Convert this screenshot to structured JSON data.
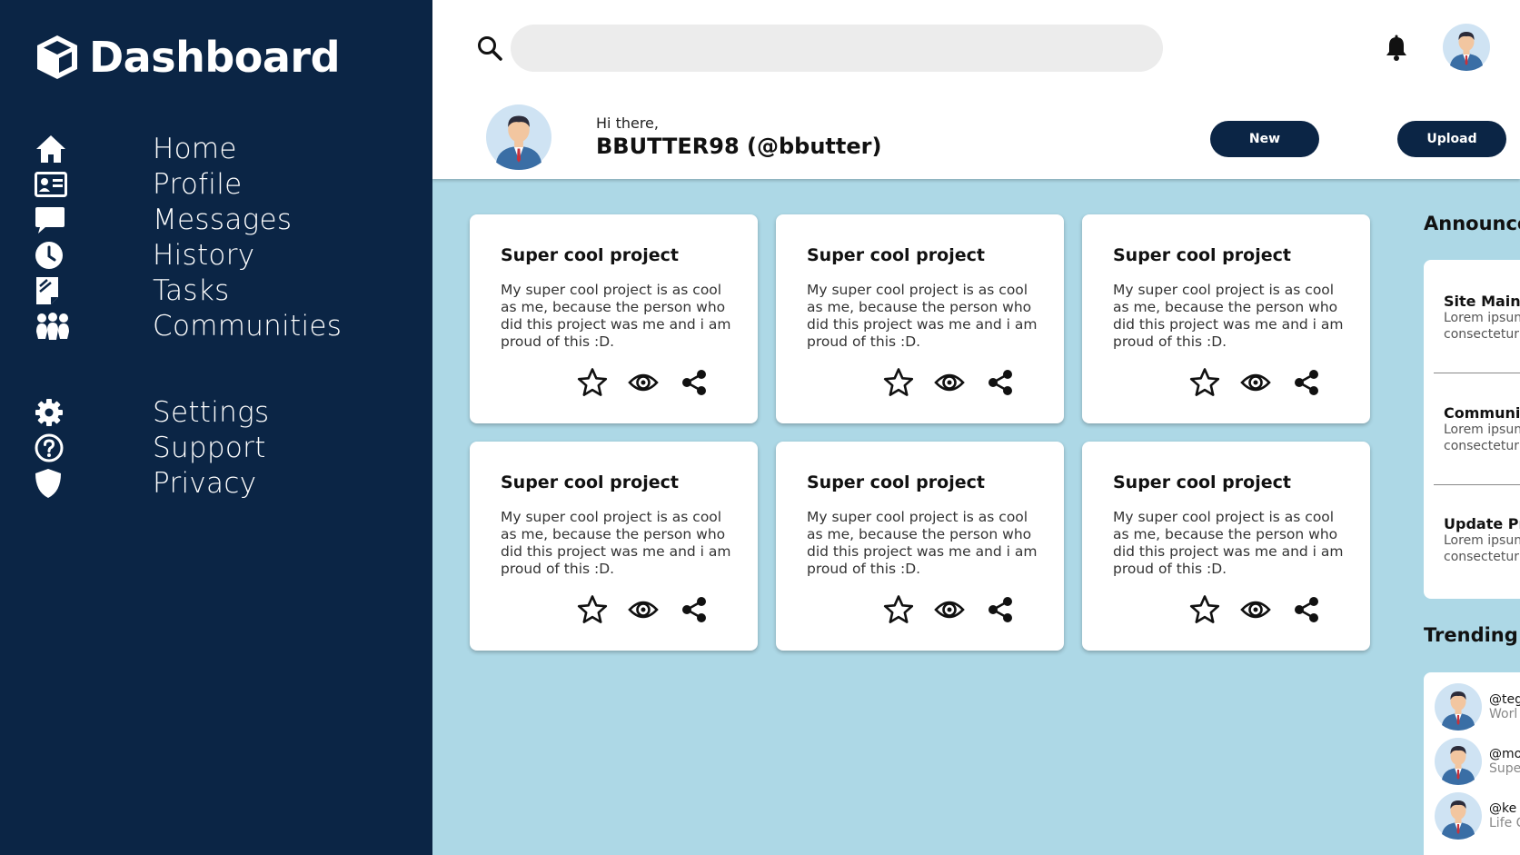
{
  "brand": {
    "title": "Dashboard"
  },
  "nav": {
    "primary": [
      {
        "label": "Home",
        "icon": "home-icon"
      },
      {
        "label": "Profile",
        "icon": "id-card-icon"
      },
      {
        "label": "Messages",
        "icon": "chat-bubble-icon"
      },
      {
        "label": "History",
        "icon": "clock-icon"
      },
      {
        "label": "Tasks",
        "icon": "document-edit-icon"
      },
      {
        "label": "Communities",
        "icon": "group-icon"
      }
    ],
    "secondary": [
      {
        "label": "Settings",
        "icon": "gear-icon"
      },
      {
        "label": "Support",
        "icon": "question-circle-icon"
      },
      {
        "label": "Privacy",
        "icon": "shield-icon"
      }
    ]
  },
  "header": {
    "search_placeholder": "",
    "greeting": "Hi there,",
    "username": "BBUTTER98 (@bbutter)",
    "new_label": "New",
    "upload_label": "Upload"
  },
  "cards": [
    {
      "title": "Super cool project",
      "description": "My super cool project is as cool as me, because the person who did this project was me and i am proud of this :D."
    },
    {
      "title": "Super cool project",
      "description": "My super cool project is as cool as me, because the person who did this project was me and i am proud of this :D."
    },
    {
      "title": "Super cool project",
      "description": "My super cool project is as cool as me, because the person who did this project was me and i am proud of this :D."
    },
    {
      "title": "Super cool project",
      "description": "My super cool project is as cool as me, because the person who did this project was me and i am proud of this :D."
    },
    {
      "title": "Super cool project",
      "description": "My super cool project is as cool as me, because the person who did this project was me and i am proud of this :D."
    },
    {
      "title": "Super cool project",
      "description": "My super cool project is as cool as me, because the person who did this project was me and i am proud of this :D."
    }
  ],
  "announcements": {
    "heading": "Announce",
    "items": [
      {
        "title": "Site Maint",
        "line1": "Lorem ipsun",
        "line2": "consectetur"
      },
      {
        "title": "Communi",
        "line1": "Lorem ipsun",
        "line2": "consectetur"
      },
      {
        "title": "Update Pr",
        "line1": "Lorem ipsun",
        "line2": "consectetur"
      }
    ]
  },
  "trending": {
    "heading": "Trending",
    "items": [
      {
        "handle": "@teg",
        "sub": "Worl"
      },
      {
        "handle": "@mo",
        "sub": "Supe"
      },
      {
        "handle": "@ke",
        "sub": "Life C"
      }
    ]
  },
  "colors": {
    "sidebar": "#0b2545",
    "content_bg": "#add8e6",
    "button": "#0b2545"
  }
}
